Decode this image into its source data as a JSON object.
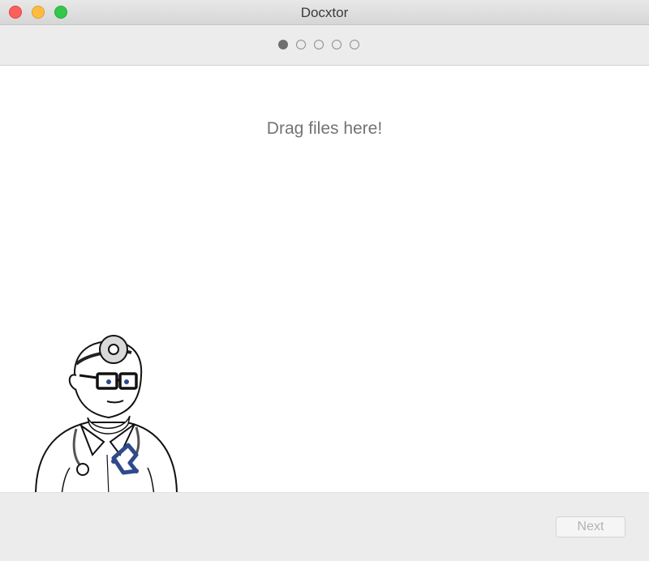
{
  "window": {
    "title": "Docxtor"
  },
  "steps": {
    "total": 5,
    "current": 1
  },
  "main": {
    "drop_prompt": "Drag files here!",
    "mascot_icon": "doctor-mascot-icon"
  },
  "footer": {
    "next_label": "Next",
    "next_enabled": false
  },
  "colors": {
    "close": "#fc605c",
    "minimize": "#fdbc40",
    "maximize": "#34c84a",
    "active_dot": "#6e6e6e"
  }
}
